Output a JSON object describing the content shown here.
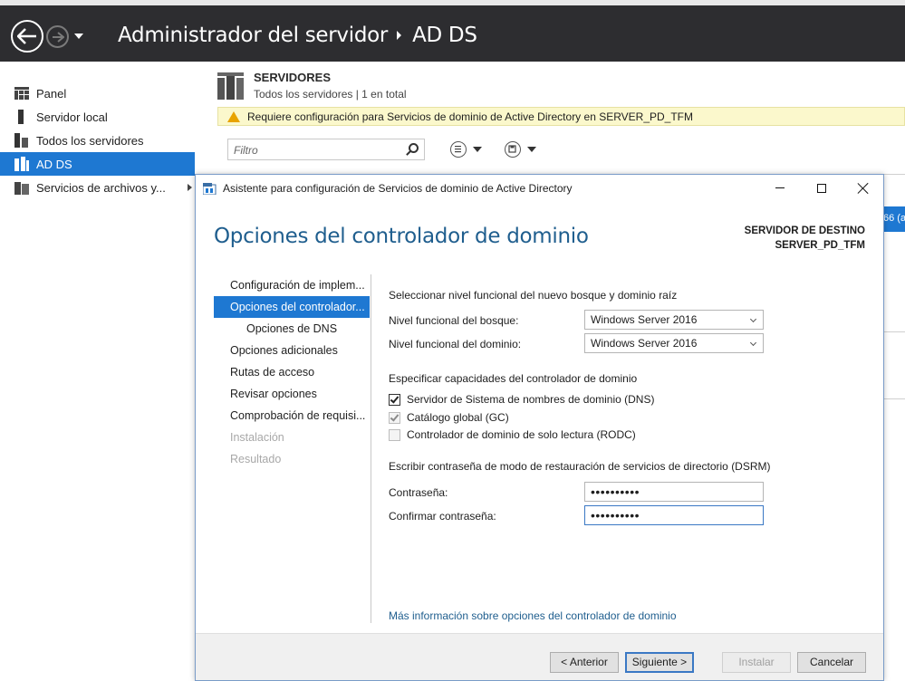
{
  "window": {
    "breadcrumb_root": "Administrador del servidor",
    "breadcrumb_current": "AD DS"
  },
  "sidebar": {
    "items": [
      {
        "label": "Panel",
        "icon": "dashboard-icon"
      },
      {
        "label": "Servidor local",
        "icon": "server-icon"
      },
      {
        "label": "Todos los servidores",
        "icon": "servers-icon"
      },
      {
        "label": "AD DS",
        "icon": "adds-icon"
      },
      {
        "label": "Servicios de archivos y...",
        "icon": "file-services-icon"
      }
    ],
    "active_index": 3
  },
  "main": {
    "servers_title": "SERVIDORES",
    "servers_subtitle": "Todos los servidores | 1 en total",
    "warning": "Requiere configuración para Servicios de dominio de Active Directory en SERVER_PD_TFM",
    "filter_placeholder": "Filtro",
    "right_peek": "66 (a"
  },
  "dialog": {
    "title": "Asistente para configuración de Servicios de dominio de Active Directory",
    "heading": "Opciones del controlador de dominio",
    "dest_label": "SERVIDOR DE DESTINO",
    "dest_server": "SERVER_PD_TFM",
    "steps": [
      {
        "label": "Configuración de implem...",
        "state": "normal"
      },
      {
        "label": "Opciones del controlador...",
        "state": "active"
      },
      {
        "label": "Opciones de DNS",
        "state": "sub"
      },
      {
        "label": "Opciones adicionales",
        "state": "normal"
      },
      {
        "label": "Rutas de acceso",
        "state": "normal"
      },
      {
        "label": "Revisar opciones",
        "state": "normal"
      },
      {
        "label": "Comprobación de requisi...",
        "state": "normal"
      },
      {
        "label": "Instalación",
        "state": "disabled"
      },
      {
        "label": "Resultado",
        "state": "disabled"
      }
    ],
    "functional_level_header": "Seleccionar nivel funcional del nuevo bosque y dominio raíz",
    "forest_level_label": "Nivel funcional del bosque:",
    "forest_level_value": "Windows Server 2016",
    "domain_level_label": "Nivel funcional del dominio:",
    "domain_level_value": "Windows Server 2016",
    "capabilities_header": "Especificar capacidades del controlador de dominio",
    "capabilities": [
      {
        "label": "Servidor de Sistema de nombres de dominio (DNS)",
        "checked": true,
        "enabled": true
      },
      {
        "label": "Catálogo global (GC)",
        "checked": true,
        "enabled": false
      },
      {
        "label": "Controlador de dominio de solo lectura (RODC)",
        "checked": false,
        "enabled": false
      }
    ],
    "dsrm_header": "Escribir contraseña de modo de restauración de servicios de directorio (DSRM)",
    "password_label": "Contraseña:",
    "password_value": "••••••••••",
    "confirm_label": "Confirmar contraseña:",
    "confirm_value": "••••••••••",
    "more_info_link": "Más información sobre opciones del controlador de dominio",
    "buttons": {
      "previous": "< Anterior",
      "next": "Siguiente >",
      "install": "Instalar",
      "cancel": "Cancelar"
    }
  },
  "colors": {
    "titlebar_bg": "#2d2d30",
    "accent": "#1e78d2",
    "heading": "#1f5e8e",
    "warning_bg": "#fbf8cc"
  }
}
